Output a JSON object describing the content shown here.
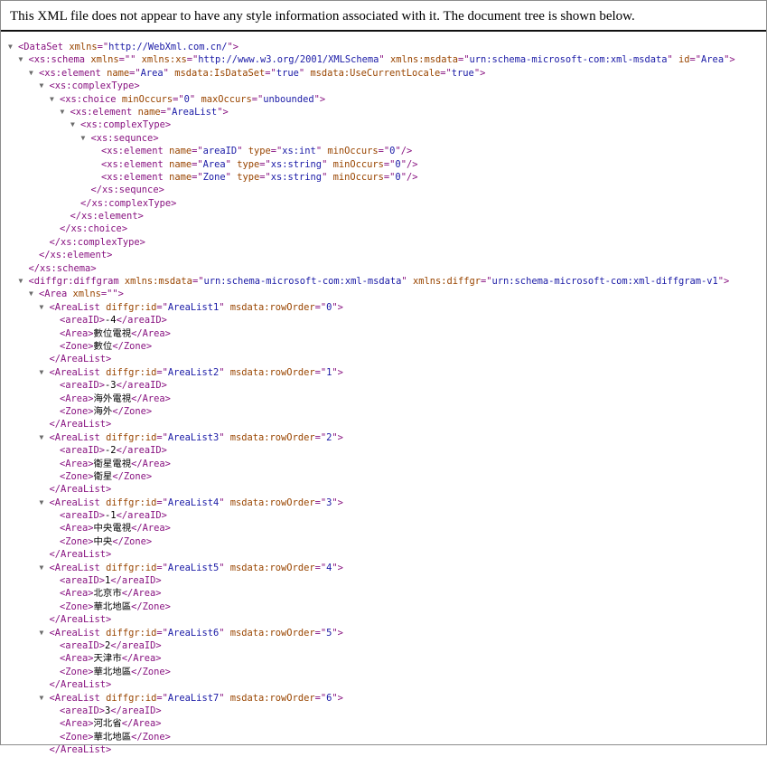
{
  "header": {
    "text": "This XML file does not appear to have any style information associated with it. The document tree is shown below."
  },
  "icons": {
    "expand_toggle": "triangle-down-icon"
  },
  "colors": {
    "tag": "#881280",
    "attr_name": "#994500",
    "attr_value": "#1a1aa6",
    "text": "#000000"
  },
  "lines": [
    {
      "d": 0,
      "t": 1,
      "p": [
        [
          "g",
          "<DataSet"
        ],
        [
          "s",
          " "
        ],
        [
          "n",
          "xmlns"
        ],
        [
          "g",
          "=\""
        ],
        [
          "v",
          "http://WebXml.com.cn/"
        ],
        [
          "g",
          "\">"
        ]
      ]
    },
    {
      "d": 1,
      "t": 1,
      "p": [
        [
          "g",
          "<xs:schema"
        ],
        [
          "s",
          " "
        ],
        [
          "n",
          "xmlns"
        ],
        [
          "g",
          "=\""
        ],
        [
          "v",
          ""
        ],
        [
          "g",
          "\""
        ],
        [
          "s",
          " "
        ],
        [
          "n",
          "xmlns:xs"
        ],
        [
          "g",
          "=\""
        ],
        [
          "v",
          "http://www.w3.org/2001/XMLSchema"
        ],
        [
          "g",
          "\""
        ],
        [
          "s",
          " "
        ],
        [
          "n",
          "xmlns:msdata"
        ],
        [
          "g",
          "=\""
        ],
        [
          "v",
          "urn:schema-microsoft-com:xml-msdata"
        ],
        [
          "g",
          "\""
        ],
        [
          "s",
          " "
        ],
        [
          "n",
          "id"
        ],
        [
          "g",
          "=\""
        ],
        [
          "v",
          "Area"
        ],
        [
          "g",
          "\">"
        ]
      ]
    },
    {
      "d": 2,
      "t": 1,
      "p": [
        [
          "g",
          "<xs:element"
        ],
        [
          "s",
          " "
        ],
        [
          "n",
          "name"
        ],
        [
          "g",
          "=\""
        ],
        [
          "v",
          "Area"
        ],
        [
          "g",
          "\""
        ],
        [
          "s",
          " "
        ],
        [
          "n",
          "msdata:IsDataSet"
        ],
        [
          "g",
          "=\""
        ],
        [
          "v",
          "true"
        ],
        [
          "g",
          "\""
        ],
        [
          "s",
          " "
        ],
        [
          "n",
          "msdata:UseCurrentLocale"
        ],
        [
          "g",
          "=\""
        ],
        [
          "v",
          "true"
        ],
        [
          "g",
          "\">"
        ]
      ]
    },
    {
      "d": 3,
      "t": 1,
      "p": [
        [
          "g",
          "<xs:complexType>"
        ]
      ]
    },
    {
      "d": 4,
      "t": 1,
      "p": [
        [
          "g",
          "<xs:choice"
        ],
        [
          "s",
          " "
        ],
        [
          "n",
          "minOccurs"
        ],
        [
          "g",
          "=\""
        ],
        [
          "v",
          "0"
        ],
        [
          "g",
          "\""
        ],
        [
          "s",
          " "
        ],
        [
          "n",
          "maxOccurs"
        ],
        [
          "g",
          "=\""
        ],
        [
          "v",
          "unbounded"
        ],
        [
          "g",
          "\">"
        ]
      ]
    },
    {
      "d": 5,
      "t": 1,
      "p": [
        [
          "g",
          "<xs:element"
        ],
        [
          "s",
          " "
        ],
        [
          "n",
          "name"
        ],
        [
          "g",
          "=\""
        ],
        [
          "v",
          "AreaList"
        ],
        [
          "g",
          "\">"
        ]
      ]
    },
    {
      "d": 6,
      "t": 1,
      "p": [
        [
          "g",
          "<xs:complexType>"
        ]
      ]
    },
    {
      "d": 7,
      "t": 1,
      "p": [
        [
          "g",
          "<xs:sequnce>"
        ]
      ]
    },
    {
      "d": 8,
      "t": 0,
      "p": [
        [
          "g",
          "<xs:element"
        ],
        [
          "s",
          " "
        ],
        [
          "n",
          "name"
        ],
        [
          "g",
          "=\""
        ],
        [
          "v",
          "areaID"
        ],
        [
          "g",
          "\""
        ],
        [
          "s",
          " "
        ],
        [
          "n",
          "type"
        ],
        [
          "g",
          "=\""
        ],
        [
          "v",
          "xs:int"
        ],
        [
          "g",
          "\""
        ],
        [
          "s",
          " "
        ],
        [
          "n",
          "minOccurs"
        ],
        [
          "g",
          "=\""
        ],
        [
          "v",
          "0"
        ],
        [
          "g",
          "\"/>"
        ]
      ]
    },
    {
      "d": 8,
      "t": 0,
      "p": [
        [
          "g",
          "<xs:element"
        ],
        [
          "s",
          " "
        ],
        [
          "n",
          "name"
        ],
        [
          "g",
          "=\""
        ],
        [
          "v",
          "Area"
        ],
        [
          "g",
          "\""
        ],
        [
          "s",
          " "
        ],
        [
          "n",
          "type"
        ],
        [
          "g",
          "=\""
        ],
        [
          "v",
          "xs:string"
        ],
        [
          "g",
          "\""
        ],
        [
          "s",
          " "
        ],
        [
          "n",
          "minOccurs"
        ],
        [
          "g",
          "=\""
        ],
        [
          "v",
          "0"
        ],
        [
          "g",
          "\"/>"
        ]
      ]
    },
    {
      "d": 8,
      "t": 0,
      "p": [
        [
          "g",
          "<xs:element"
        ],
        [
          "s",
          " "
        ],
        [
          "n",
          "name"
        ],
        [
          "g",
          "=\""
        ],
        [
          "v",
          "Zone"
        ],
        [
          "g",
          "\""
        ],
        [
          "s",
          " "
        ],
        [
          "n",
          "type"
        ],
        [
          "g",
          "=\""
        ],
        [
          "v",
          "xs:string"
        ],
        [
          "g",
          "\""
        ],
        [
          "s",
          " "
        ],
        [
          "n",
          "minOccurs"
        ],
        [
          "g",
          "=\""
        ],
        [
          "v",
          "0"
        ],
        [
          "g",
          "\"/>"
        ]
      ]
    },
    {
      "d": 7,
      "t": 0,
      "p": [
        [
          "g",
          "</xs:sequnce>"
        ]
      ]
    },
    {
      "d": 6,
      "t": 0,
      "p": [
        [
          "g",
          "</xs:complexType>"
        ]
      ]
    },
    {
      "d": 5,
      "t": 0,
      "p": [
        [
          "g",
          "</xs:element>"
        ]
      ]
    },
    {
      "d": 4,
      "t": 0,
      "p": [
        [
          "g",
          "</xs:choice>"
        ]
      ]
    },
    {
      "d": 3,
      "t": 0,
      "p": [
        [
          "g",
          "</xs:complexType>"
        ]
      ]
    },
    {
      "d": 2,
      "t": 0,
      "p": [
        [
          "g",
          "</xs:element>"
        ]
      ]
    },
    {
      "d": 1,
      "t": 0,
      "p": [
        [
          "g",
          "</xs:schema>"
        ]
      ]
    },
    {
      "d": 1,
      "t": 1,
      "p": [
        [
          "g",
          "<diffgr:diffgram"
        ],
        [
          "s",
          " "
        ],
        [
          "n",
          "xmlns:msdata"
        ],
        [
          "g",
          "=\""
        ],
        [
          "v",
          "urn:schema-microsoft-com:xml-msdata"
        ],
        [
          "g",
          "\""
        ],
        [
          "s",
          " "
        ],
        [
          "n",
          "xmlns:diffgr"
        ],
        [
          "g",
          "=\""
        ],
        [
          "v",
          "urn:schema-microsoft-com:xml-diffgram-v1"
        ],
        [
          "g",
          "\">"
        ]
      ]
    },
    {
      "d": 2,
      "t": 1,
      "p": [
        [
          "g",
          "<Area"
        ],
        [
          "s",
          " "
        ],
        [
          "n",
          "xmlns"
        ],
        [
          "g",
          "=\""
        ],
        [
          "v",
          ""
        ],
        [
          "g",
          "\">"
        ]
      ]
    },
    {
      "d": 3,
      "t": 1,
      "p": [
        [
          "g",
          "<AreaList"
        ],
        [
          "s",
          " "
        ],
        [
          "n",
          "diffgr:id"
        ],
        [
          "g",
          "=\""
        ],
        [
          "v",
          "AreaList1"
        ],
        [
          "g",
          "\""
        ],
        [
          "s",
          " "
        ],
        [
          "n",
          "msdata:rowOrder"
        ],
        [
          "g",
          "=\""
        ],
        [
          "v",
          "0"
        ],
        [
          "g",
          "\">"
        ]
      ]
    },
    {
      "d": 4,
      "t": 0,
      "p": [
        [
          "g",
          "<areaID>"
        ],
        [
          "x",
          "-4"
        ],
        [
          "g",
          "</areaID>"
        ]
      ]
    },
    {
      "d": 4,
      "t": 0,
      "p": [
        [
          "g",
          "<Area>"
        ],
        [
          "x",
          "數位電視"
        ],
        [
          "g",
          "</Area>"
        ]
      ]
    },
    {
      "d": 4,
      "t": 0,
      "p": [
        [
          "g",
          "<Zone>"
        ],
        [
          "x",
          "數位"
        ],
        [
          "g",
          "</Zone>"
        ]
      ]
    },
    {
      "d": 3,
      "t": 0,
      "p": [
        [
          "g",
          "</AreaList>"
        ]
      ]
    },
    {
      "d": 3,
      "t": 1,
      "p": [
        [
          "g",
          "<AreaList"
        ],
        [
          "s",
          " "
        ],
        [
          "n",
          "diffgr:id"
        ],
        [
          "g",
          "=\""
        ],
        [
          "v",
          "AreaList2"
        ],
        [
          "g",
          "\""
        ],
        [
          "s",
          " "
        ],
        [
          "n",
          "msdata:rowOrder"
        ],
        [
          "g",
          "=\""
        ],
        [
          "v",
          "1"
        ],
        [
          "g",
          "\">"
        ]
      ]
    },
    {
      "d": 4,
      "t": 0,
      "p": [
        [
          "g",
          "<areaID>"
        ],
        [
          "x",
          "-3"
        ],
        [
          "g",
          "</areaID>"
        ]
      ]
    },
    {
      "d": 4,
      "t": 0,
      "p": [
        [
          "g",
          "<Area>"
        ],
        [
          "x",
          "海外電視"
        ],
        [
          "g",
          "</Area>"
        ]
      ]
    },
    {
      "d": 4,
      "t": 0,
      "p": [
        [
          "g",
          "<Zone>"
        ],
        [
          "x",
          "海外"
        ],
        [
          "g",
          "</Zone>"
        ]
      ]
    },
    {
      "d": 3,
      "t": 0,
      "p": [
        [
          "g",
          "</AreaList>"
        ]
      ]
    },
    {
      "d": 3,
      "t": 1,
      "p": [
        [
          "g",
          "<AreaList"
        ],
        [
          "s",
          " "
        ],
        [
          "n",
          "diffgr:id"
        ],
        [
          "g",
          "=\""
        ],
        [
          "v",
          "AreaList3"
        ],
        [
          "g",
          "\""
        ],
        [
          "s",
          " "
        ],
        [
          "n",
          "msdata:rowOrder"
        ],
        [
          "g",
          "=\""
        ],
        [
          "v",
          "2"
        ],
        [
          "g",
          "\">"
        ]
      ]
    },
    {
      "d": 4,
      "t": 0,
      "p": [
        [
          "g",
          "<areaID>"
        ],
        [
          "x",
          "-2"
        ],
        [
          "g",
          "</areaID>"
        ]
      ]
    },
    {
      "d": 4,
      "t": 0,
      "p": [
        [
          "g",
          "<Area>"
        ],
        [
          "x",
          "衛星電視"
        ],
        [
          "g",
          "</Area>"
        ]
      ]
    },
    {
      "d": 4,
      "t": 0,
      "p": [
        [
          "g",
          "<Zone>"
        ],
        [
          "x",
          "衛星"
        ],
        [
          "g",
          "</Zone>"
        ]
      ]
    },
    {
      "d": 3,
      "t": 0,
      "p": [
        [
          "g",
          "</AreaList>"
        ]
      ]
    },
    {
      "d": 3,
      "t": 1,
      "p": [
        [
          "g",
          "<AreaList"
        ],
        [
          "s",
          " "
        ],
        [
          "n",
          "diffgr:id"
        ],
        [
          "g",
          "=\""
        ],
        [
          "v",
          "AreaList4"
        ],
        [
          "g",
          "\""
        ],
        [
          "s",
          " "
        ],
        [
          "n",
          "msdata:rowOrder"
        ],
        [
          "g",
          "=\""
        ],
        [
          "v",
          "3"
        ],
        [
          "g",
          "\">"
        ]
      ]
    },
    {
      "d": 4,
      "t": 0,
      "p": [
        [
          "g",
          "<areaID>"
        ],
        [
          "x",
          "-1"
        ],
        [
          "g",
          "</areaID>"
        ]
      ]
    },
    {
      "d": 4,
      "t": 0,
      "p": [
        [
          "g",
          "<Area>"
        ],
        [
          "x",
          "中央電視"
        ],
        [
          "g",
          "</Area>"
        ]
      ]
    },
    {
      "d": 4,
      "t": 0,
      "p": [
        [
          "g",
          "<Zone>"
        ],
        [
          "x",
          "中央"
        ],
        [
          "g",
          "</Zone>"
        ]
      ]
    },
    {
      "d": 3,
      "t": 0,
      "p": [
        [
          "g",
          "</AreaList>"
        ]
      ]
    },
    {
      "d": 3,
      "t": 1,
      "p": [
        [
          "g",
          "<AreaList"
        ],
        [
          "s",
          " "
        ],
        [
          "n",
          "diffgr:id"
        ],
        [
          "g",
          "=\""
        ],
        [
          "v",
          "AreaList5"
        ],
        [
          "g",
          "\""
        ],
        [
          "s",
          " "
        ],
        [
          "n",
          "msdata:rowOrder"
        ],
        [
          "g",
          "=\""
        ],
        [
          "v",
          "4"
        ],
        [
          "g",
          "\">"
        ]
      ]
    },
    {
      "d": 4,
      "t": 0,
      "p": [
        [
          "g",
          "<areaID>"
        ],
        [
          "x",
          "1"
        ],
        [
          "g",
          "</areaID>"
        ]
      ]
    },
    {
      "d": 4,
      "t": 0,
      "p": [
        [
          "g",
          "<Area>"
        ],
        [
          "x",
          "北京市"
        ],
        [
          "g",
          "</Area>"
        ]
      ]
    },
    {
      "d": 4,
      "t": 0,
      "p": [
        [
          "g",
          "<Zone>"
        ],
        [
          "x",
          "華北地區"
        ],
        [
          "g",
          "</Zone>"
        ]
      ]
    },
    {
      "d": 3,
      "t": 0,
      "p": [
        [
          "g",
          "</AreaList>"
        ]
      ]
    },
    {
      "d": 3,
      "t": 1,
      "p": [
        [
          "g",
          "<AreaList"
        ],
        [
          "s",
          " "
        ],
        [
          "n",
          "diffgr:id"
        ],
        [
          "g",
          "=\""
        ],
        [
          "v",
          "AreaList6"
        ],
        [
          "g",
          "\""
        ],
        [
          "s",
          " "
        ],
        [
          "n",
          "msdata:rowOrder"
        ],
        [
          "g",
          "=\""
        ],
        [
          "v",
          "5"
        ],
        [
          "g",
          "\">"
        ]
      ]
    },
    {
      "d": 4,
      "t": 0,
      "p": [
        [
          "g",
          "<areaID>"
        ],
        [
          "x",
          "2"
        ],
        [
          "g",
          "</areaID>"
        ]
      ]
    },
    {
      "d": 4,
      "t": 0,
      "p": [
        [
          "g",
          "<Area>"
        ],
        [
          "x",
          "天津市"
        ],
        [
          "g",
          "</Area>"
        ]
      ]
    },
    {
      "d": 4,
      "t": 0,
      "p": [
        [
          "g",
          "<Zone>"
        ],
        [
          "x",
          "華北地區"
        ],
        [
          "g",
          "</Zone>"
        ]
      ]
    },
    {
      "d": 3,
      "t": 0,
      "p": [
        [
          "g",
          "</AreaList>"
        ]
      ]
    },
    {
      "d": 3,
      "t": 1,
      "p": [
        [
          "g",
          "<AreaList"
        ],
        [
          "s",
          " "
        ],
        [
          "n",
          "diffgr:id"
        ],
        [
          "g",
          "=\""
        ],
        [
          "v",
          "AreaList7"
        ],
        [
          "g",
          "\""
        ],
        [
          "s",
          " "
        ],
        [
          "n",
          "msdata:rowOrder"
        ],
        [
          "g",
          "=\""
        ],
        [
          "v",
          "6"
        ],
        [
          "g",
          "\">"
        ]
      ]
    },
    {
      "d": 4,
      "t": 0,
      "p": [
        [
          "g",
          "<areaID>"
        ],
        [
          "x",
          "3"
        ],
        [
          "g",
          "</areaID>"
        ]
      ]
    },
    {
      "d": 4,
      "t": 0,
      "p": [
        [
          "g",
          "<Area>"
        ],
        [
          "x",
          "河北省"
        ],
        [
          "g",
          "</Area>"
        ]
      ]
    },
    {
      "d": 4,
      "t": 0,
      "p": [
        [
          "g",
          "<Zone>"
        ],
        [
          "x",
          "華北地區"
        ],
        [
          "g",
          "</Zone>"
        ]
      ]
    },
    {
      "d": 3,
      "t": 0,
      "p": [
        [
          "g",
          "</AreaList>"
        ]
      ]
    }
  ]
}
